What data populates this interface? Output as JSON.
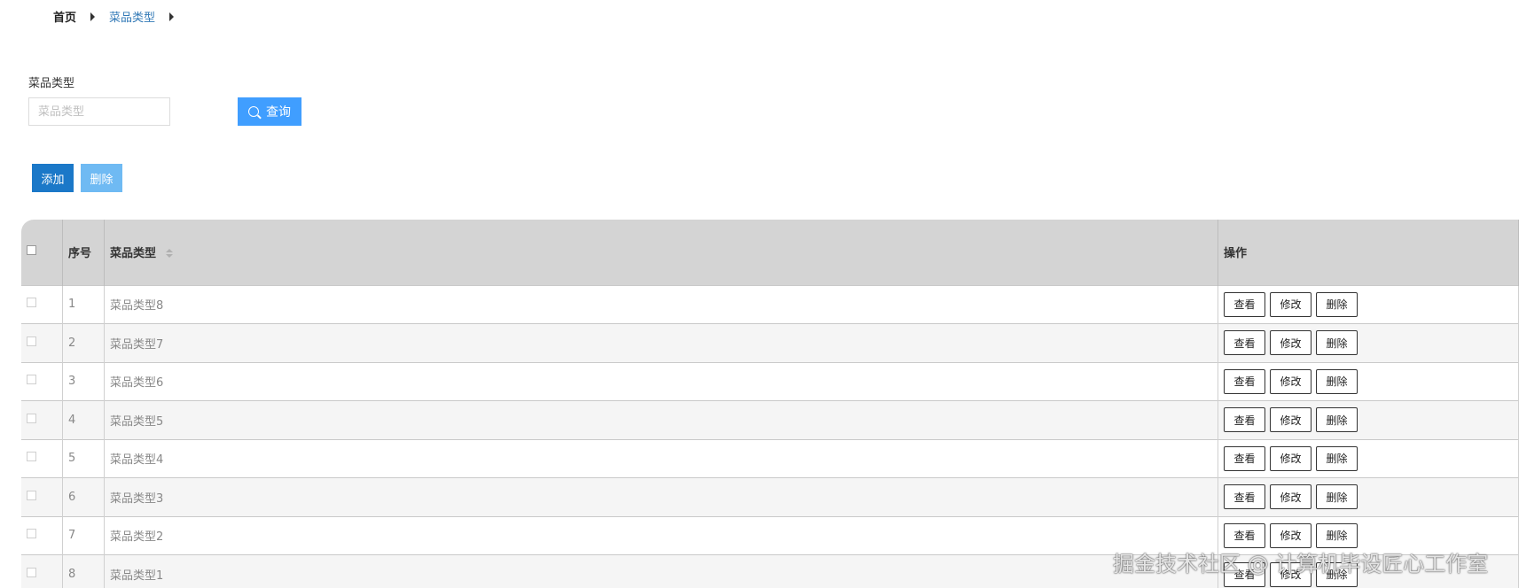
{
  "breadcrumb": {
    "home": "首页",
    "current": "菜品类型"
  },
  "search": {
    "label": "菜品类型",
    "placeholder": "菜品类型",
    "value": "",
    "button_label": "查询"
  },
  "actions": {
    "add_label": "添加",
    "delete_label": "删除"
  },
  "table": {
    "columns": {
      "index": "序号",
      "type": "菜品类型",
      "ops": "操作"
    },
    "op_labels": {
      "view": "查看",
      "edit": "修改",
      "delete": "删除"
    },
    "rows": [
      {
        "index": "1",
        "type": "菜品类型8"
      },
      {
        "index": "2",
        "type": "菜品类型7"
      },
      {
        "index": "3",
        "type": "菜品类型6"
      },
      {
        "index": "4",
        "type": "菜品类型5"
      },
      {
        "index": "5",
        "type": "菜品类型4"
      },
      {
        "index": "6",
        "type": "菜品类型3"
      },
      {
        "index": "7",
        "type": "菜品类型2"
      },
      {
        "index": "8",
        "type": "菜品类型1"
      }
    ]
  },
  "watermark": "掘金技术社区 @ 计算机毕设匠心工作室",
  "colors": {
    "primary": "#1b78c8",
    "search_button": "#409eff",
    "delete_button": "#6fbaf3",
    "header_bg": "#d4d4d4",
    "link": "#337ab7"
  }
}
